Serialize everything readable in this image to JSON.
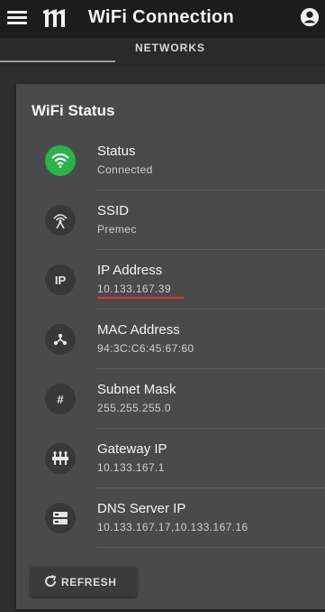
{
  "header": {
    "title": "WiFi Connection",
    "menu_icon": "hamburger-menu-icon",
    "logo_icon": "brand-logo",
    "account_icon": "account-circle-icon"
  },
  "tabs": {
    "networks_label": "NETWORKS"
  },
  "status_card": {
    "title": "WiFi Status",
    "rows": [
      {
        "label": "Status",
        "value": "Connected",
        "icon": "wifi-icon",
        "icon_color": "#29b34a"
      },
      {
        "label": "SSID",
        "value": "Premec",
        "icon": "wifi-tower-icon"
      },
      {
        "label": "IP Address",
        "value": "10.133.167.39",
        "icon": "ip-icon",
        "icon_text": "IP"
      },
      {
        "label": "MAC Address",
        "value": "94:3C:C6:45:67:60",
        "icon": "network-nodes-icon"
      },
      {
        "label": "Subnet Mask",
        "value": "255.255.255.0",
        "icon": "hash-icon",
        "icon_text": "#"
      },
      {
        "label": "Gateway IP",
        "value": "10.133.167.1",
        "icon": "gateway-icon"
      },
      {
        "label": "DNS Server IP",
        "value": "10.133.167.17,10.133.167.16",
        "icon": "server-icon"
      }
    ],
    "refresh_label": "REFRESH",
    "refresh_icon": "refresh-icon"
  },
  "colors": {
    "accent_green": "#29b34a",
    "highlight_red": "#e0323a"
  }
}
